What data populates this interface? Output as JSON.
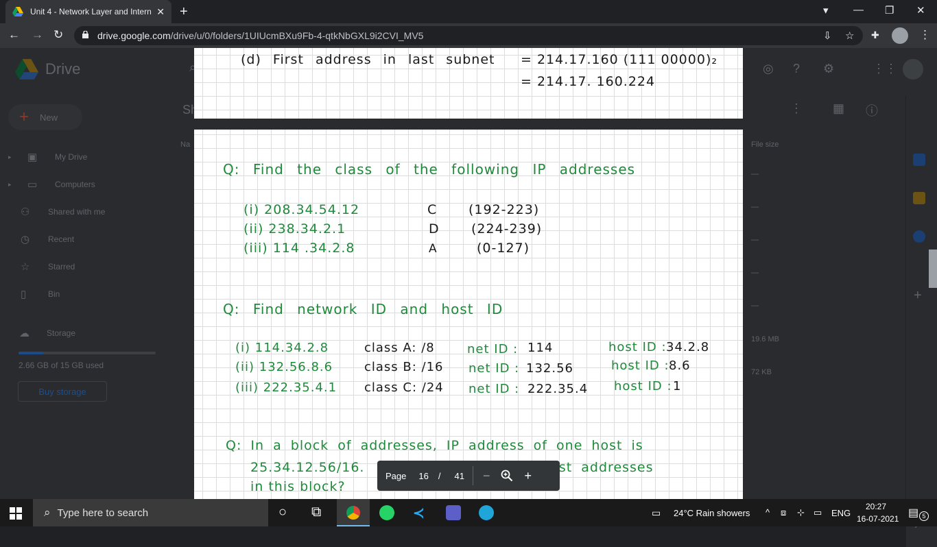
{
  "browser": {
    "tab_title": "Unit 4 - Network Layer and Intern",
    "url_host": "drive.google.com",
    "url_path": "/drive/u/0/folders/1UIUcmBXu9Fb-4-qtkNbGXL9i2CVI_MV5"
  },
  "drive": {
    "title": "Drive",
    "new_label": "New",
    "nav": [
      "My Drive",
      "Computers",
      "Shared with me",
      "Recent",
      "Starred",
      "Bin"
    ],
    "storage_label": "Storage",
    "storage_used": "2.66 GB of 15 GB used",
    "storage_fraction": 0.18,
    "buy_storage": "Buy storage",
    "header_partial": "Sh",
    "col_name_partial": "Na",
    "col_file_size": "File size",
    "file_sizes": [
      "—",
      "—",
      "—",
      "—",
      "—",
      "19.6 MB",
      "72 KB"
    ]
  },
  "document": {
    "page1": {
      "line1_left": "(d) First address in last subnet",
      "line1_right": "= 214.17.160 (111 00000)₂",
      "line2_right": "= 214.17. 160.224"
    },
    "q1": {
      "title": "Q: Find the class of the following IP addresses",
      "rows": [
        {
          "ip": "(i) 208.34.54.12",
          "cls": "C",
          "range": "(192-223)"
        },
        {
          "ip": "(ii) 238.34.2.1",
          "cls": "D",
          "range": "(224-239)"
        },
        {
          "ip": "(iii) 114 .34.2.8",
          "cls": "A",
          "range": "(0-127)"
        }
      ]
    },
    "q2": {
      "title": "Q: Find network ID and host ID",
      "rows": [
        {
          "ip": "(i) 114.34.2.8",
          "cls": "class A: /8",
          "net_label": "net ID :",
          "net": "114",
          "host_label": "host ID :",
          "host": "34.2.8"
        },
        {
          "ip": "(ii) 132.56.8.6",
          "cls": "class B: /16",
          "net_label": "net ID :",
          "net": "132.56",
          "host_label": "host ID :",
          "host": "8.6"
        },
        {
          "ip": "(iii) 222.35.4.1",
          "cls": "class C: /24",
          "net_label": "net ID :",
          "net": "222.35.4",
          "host_label": "host ID :",
          "host": "1"
        }
      ]
    },
    "q3": {
      "line1": "Q: In a block of addresses, IP address of one host is",
      "line2_start": "25.34.12.56/16.",
      "line2_end": "What are the first & last addresses",
      "line3": "in this block?"
    }
  },
  "pager": {
    "label": "Page",
    "current": "16",
    "separator": "/",
    "total": "41"
  },
  "taskbar": {
    "search_placeholder": "Type here to search",
    "weather": "24°C  Rain showers",
    "lang": "ENG",
    "time": "20:27",
    "date": "16-07-2021",
    "notifications": "5"
  }
}
